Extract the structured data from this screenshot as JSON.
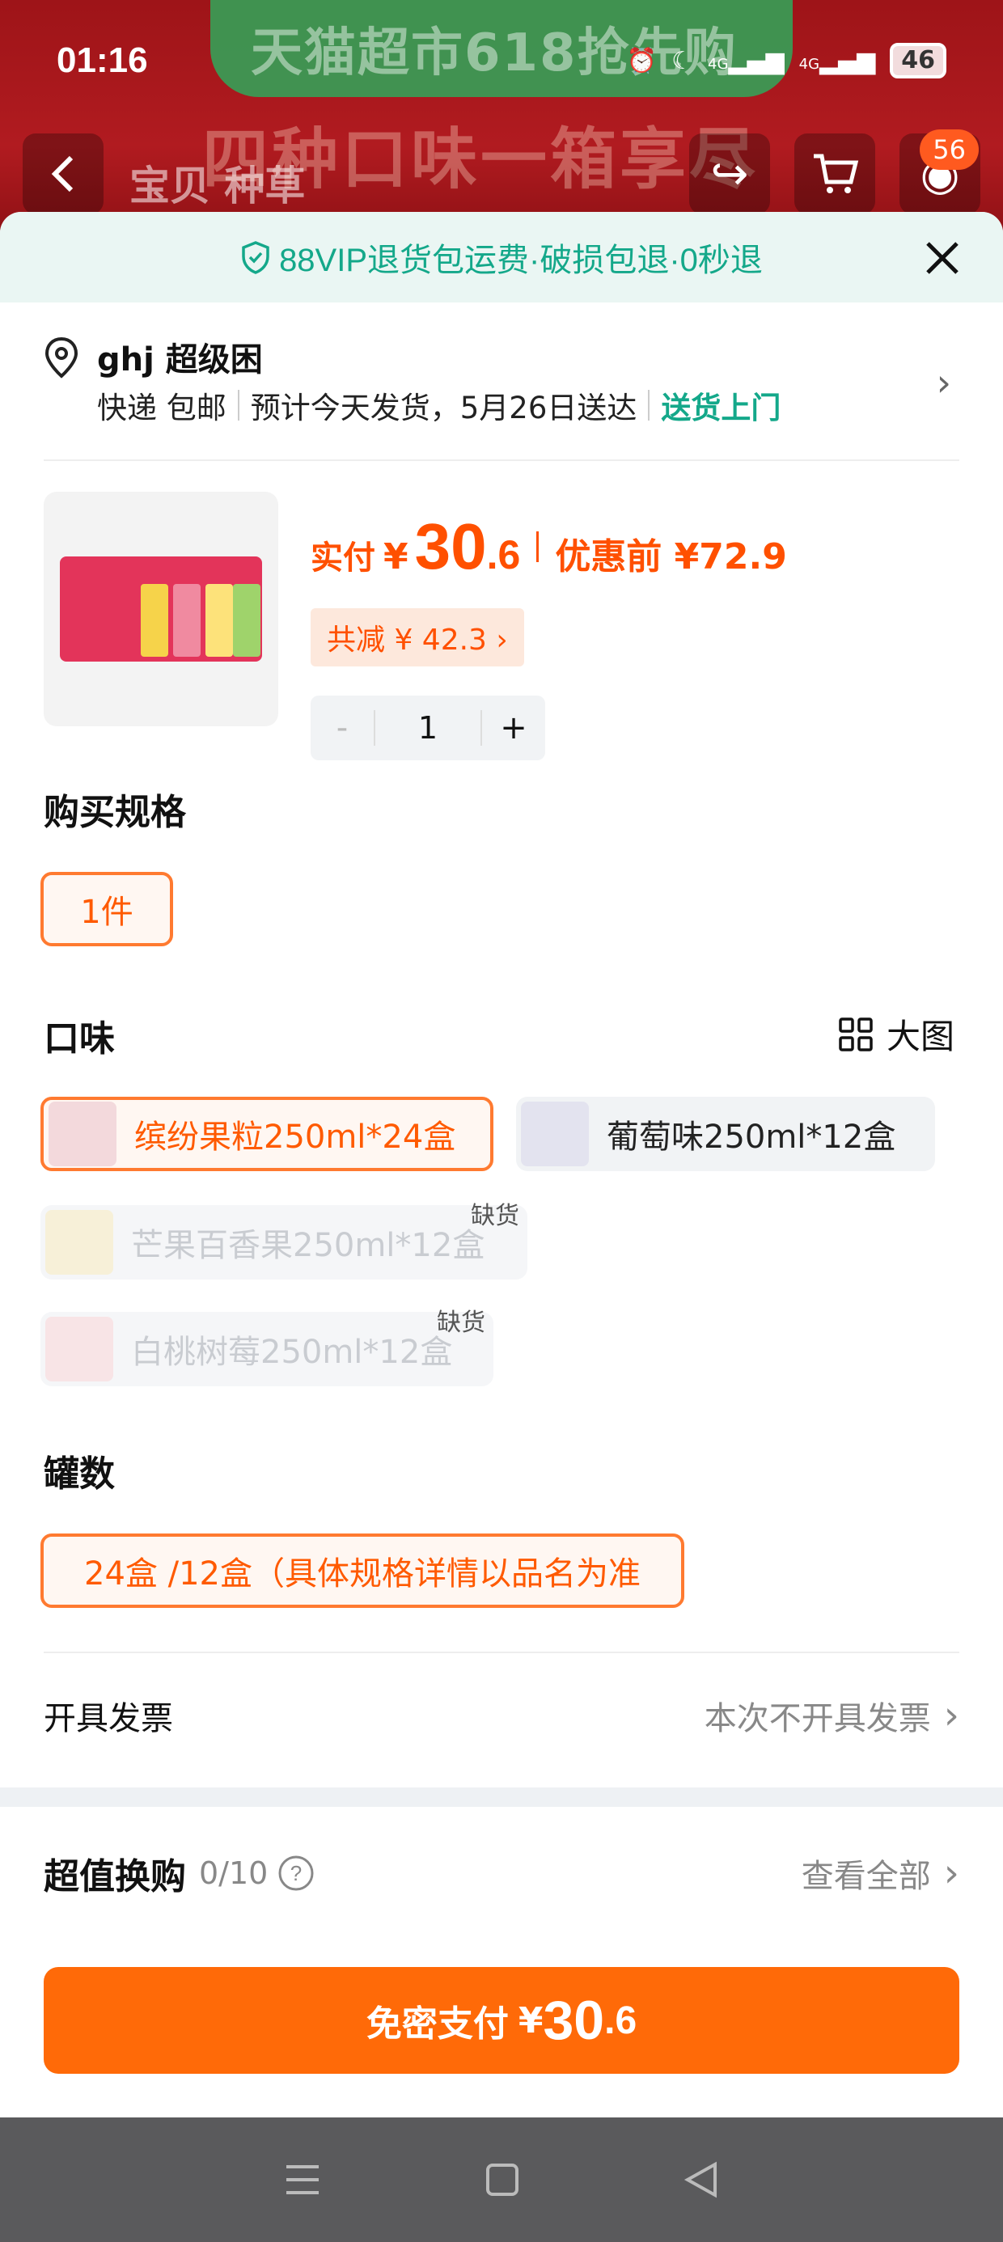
{
  "status_bar": {
    "time": "01:16",
    "battery": "46",
    "net1": "4G",
    "net2": "4G"
  },
  "banner": {
    "title": "天猫超市618抢先购",
    "subtitle": "四种口味一箱享尽"
  },
  "top_nav": {
    "tabs": "宝贝  种草",
    "cart_badge": "56"
  },
  "vip_bar": {
    "text": "88VIP退货包运费·破损包退·0秒退"
  },
  "address": {
    "name": "ghj 超级困",
    "delivery_method": "快递 包邮",
    "estimate": "预计今天发货，5月26日送达",
    "door_delivery": "送货上门"
  },
  "product": {
    "paid_label": "实付",
    "currency": "¥",
    "price_int": "30",
    "price_dec": ".6",
    "before_label": "优惠前 ¥72.9",
    "discount": "共减 ¥ 42.3 ›",
    "quantity": "1",
    "minus": "-",
    "plus": "+"
  },
  "spec": {
    "title": "购买规格",
    "options": [
      {
        "label": "1件",
        "selected": true
      }
    ]
  },
  "flavor": {
    "title": "口味",
    "big_view_label": "大图",
    "out_of_stock_label": "缺货",
    "options": [
      {
        "label": "缤纷果粒250ml*24盒",
        "state": "selected"
      },
      {
        "label": "葡萄味250ml*12盒",
        "state": "normal"
      },
      {
        "label": "芒果百香果250ml*12盒",
        "state": "disabled"
      },
      {
        "label": "白桃树莓250ml*12盒",
        "state": "disabled"
      }
    ]
  },
  "cans": {
    "title": "罐数",
    "options": [
      {
        "label": "24盒 /12盒（具体规格详情以品名为准",
        "selected": true
      }
    ]
  },
  "invoice": {
    "label": "开具发票",
    "value": "本次不开具发票"
  },
  "exchange": {
    "title": "超值换购",
    "count": "0/10",
    "view_all": "查看全部"
  },
  "pay_button": {
    "label": "免密支付",
    "currency": "¥",
    "price_int": "30",
    "price_dec": ".6"
  },
  "colors": {
    "accent": "#ff6a08",
    "vip_green": "#14a88a",
    "price": "#ff5000"
  }
}
